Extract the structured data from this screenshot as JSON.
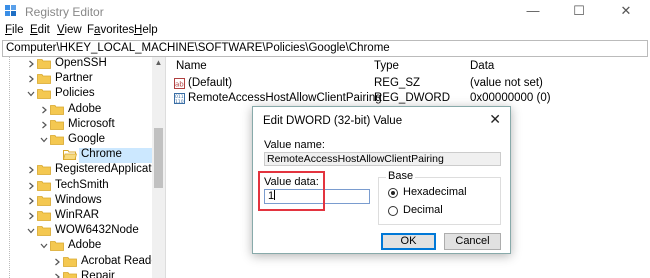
{
  "window": {
    "title": "Registry Editor",
    "minimize": "—",
    "maximize": "☐",
    "close": "✕"
  },
  "menu": [
    {
      "key": "F",
      "rest": "ile"
    },
    {
      "key": "E",
      "rest": "dit"
    },
    {
      "key": "V",
      "rest": "iew"
    },
    {
      "pre": "F",
      "key": "a",
      "rest": "vorites"
    },
    {
      "key": "H",
      "rest": "elp"
    }
  ],
  "address": "Computer\\HKEY_LOCAL_MACHINE\\SOFTWARE\\Policies\\Google\\Chrome",
  "tree": [
    {
      "label": "OpenSSH",
      "expanded": false
    },
    {
      "label": "Partner",
      "expanded": false
    },
    {
      "label": "Policies",
      "expanded": true
    },
    {
      "label": "Adobe",
      "expanded": false
    },
    {
      "label": "Microsoft",
      "expanded": false
    },
    {
      "label": "Google",
      "expanded": true
    },
    {
      "label": "Chrome",
      "selected": true
    },
    {
      "label": "RegisteredApplication",
      "expanded": false
    },
    {
      "label": "TechSmith",
      "expanded": false
    },
    {
      "label": "Windows",
      "expanded": false
    },
    {
      "label": "WinRAR",
      "expanded": false
    },
    {
      "label": "WOW6432Node",
      "expanded": true
    },
    {
      "label": "Adobe",
      "expanded": true
    },
    {
      "label": "Acrobat Reader",
      "expanded": false
    },
    {
      "label": "Repair",
      "expanded": false
    }
  ],
  "list": {
    "headers": {
      "name": "Name",
      "type": "Type",
      "data": "Data"
    },
    "rows": [
      {
        "name": "(Default)",
        "type": "REG_SZ",
        "data": "(value not set)",
        "icon": "ab"
      },
      {
        "name": "RemoteAccessHostAllowClientPairing",
        "type": "REG_DWORD",
        "data": "0x00000000 (0)",
        "icon": "dword"
      }
    ]
  },
  "dialog": {
    "title": "Edit DWORD (32-bit) Value",
    "close": "✕",
    "value_name_label": "Value name:",
    "value_name": "RemoteAccessHostAllowClientPairing",
    "value_data_label": "Value data:",
    "value_data": "1",
    "base_label": "Base",
    "hex_label": "Hexadecimal",
    "dec_label": "Decimal",
    "base_selected": "Hexadecimal",
    "ok": "OK",
    "cancel": "Cancel"
  },
  "colors": {
    "highlight": "#e3343f",
    "folder": "#f4c851",
    "selection": "#cce8ff"
  }
}
